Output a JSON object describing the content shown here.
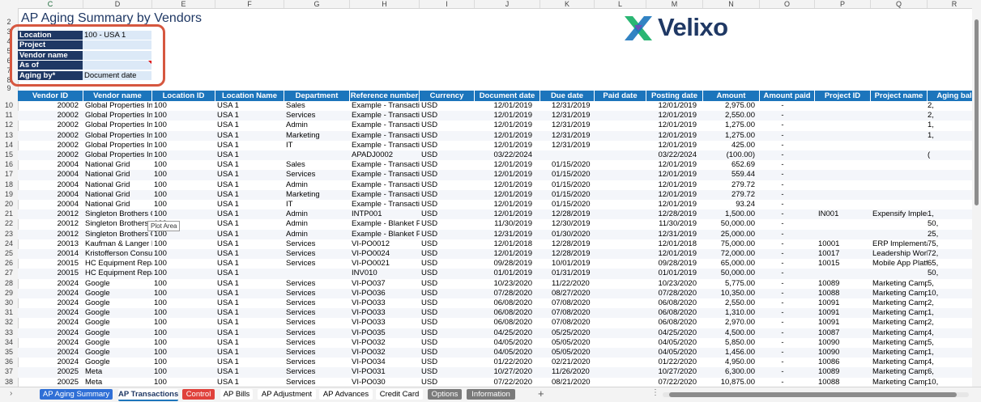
{
  "sheet": {
    "title": "AP Aging Summary by Vendors",
    "column_letters": [
      "C",
      "D",
      "E",
      "F",
      "G",
      "H",
      "I",
      "J",
      "K",
      "L",
      "M",
      "N",
      "O",
      "P",
      "Q",
      "R"
    ],
    "brand": "Velixo"
  },
  "params": [
    {
      "label": "Location",
      "value": "100 - USA 1"
    },
    {
      "label": "Project",
      "value": ""
    },
    {
      "label": "Vendor name",
      "value": ""
    },
    {
      "label": "As of",
      "value": ""
    },
    {
      "label": "Aging by*",
      "value": "Document date"
    }
  ],
  "table": {
    "headers": [
      "Vendor ID",
      "Vendor name",
      "Location ID",
      "Location Name",
      "Department",
      "Reference number",
      "Currency",
      "Document date",
      "Due date",
      "Paid date",
      "Posting date",
      "Amount",
      "Amount paid",
      "Project ID",
      "Project name",
      "Aging bal"
    ],
    "rows": [
      [
        "20002",
        "Global Properties In",
        "100",
        "USA 1",
        "Sales",
        "Example - Transactio",
        "USD",
        "12/01/2019",
        "12/31/2019",
        "",
        "12/01/2019",
        "2,975.00",
        "-",
        "",
        "",
        "2,"
      ],
      [
        "20002",
        "Global Properties In",
        "100",
        "USA 1",
        "Services",
        "Example - Transactio",
        "USD",
        "12/01/2019",
        "12/31/2019",
        "",
        "12/01/2019",
        "2,550.00",
        "-",
        "",
        "",
        "2,"
      ],
      [
        "20002",
        "Global Properties In",
        "100",
        "USA 1",
        "Admin",
        "Example - Transactio",
        "USD",
        "12/01/2019",
        "12/31/2019",
        "",
        "12/01/2019",
        "1,275.00",
        "-",
        "",
        "",
        "1,"
      ],
      [
        "20002",
        "Global Properties In",
        "100",
        "USA 1",
        "Marketing",
        "Example - Transactio",
        "USD",
        "12/01/2019",
        "12/31/2019",
        "",
        "12/01/2019",
        "1,275.00",
        "-",
        "",
        "",
        "1,"
      ],
      [
        "20002",
        "Global Properties In",
        "100",
        "USA 1",
        "IT",
        "Example - Transactio",
        "USD",
        "12/01/2019",
        "12/31/2019",
        "",
        "12/01/2019",
        "425.00",
        "-",
        "",
        "",
        ""
      ],
      [
        "20002",
        "Global Properties In",
        "100",
        "USA 1",
        "",
        "APADJ0002",
        "USD",
        "03/22/2024",
        "",
        "",
        "03/22/2024",
        "(100.00)",
        "-",
        "",
        "",
        "("
      ],
      [
        "20004",
        "National Grid",
        "100",
        "USA 1",
        "Sales",
        "Example - Transactio",
        "USD",
        "12/01/2019",
        "01/15/2020",
        "",
        "12/01/2019",
        "652.69",
        "-",
        "",
        "",
        ""
      ],
      [
        "20004",
        "National Grid",
        "100",
        "USA 1",
        "Services",
        "Example - Transactio",
        "USD",
        "12/01/2019",
        "01/15/2020",
        "",
        "12/01/2019",
        "559.44",
        "-",
        "",
        "",
        ""
      ],
      [
        "20004",
        "National Grid",
        "100",
        "USA 1",
        "Admin",
        "Example - Transactio",
        "USD",
        "12/01/2019",
        "01/15/2020",
        "",
        "12/01/2019",
        "279.72",
        "-",
        "",
        "",
        ""
      ],
      [
        "20004",
        "National Grid",
        "100",
        "USA 1",
        "Marketing",
        "Example - Transactio",
        "USD",
        "12/01/2019",
        "01/15/2020",
        "",
        "12/01/2019",
        "279.72",
        "-",
        "",
        "",
        ""
      ],
      [
        "20004",
        "National Grid",
        "100",
        "USA 1",
        "IT",
        "Example - Transactio",
        "USD",
        "12/01/2019",
        "01/15/2020",
        "",
        "12/01/2019",
        "93.24",
        "-",
        "",
        "",
        ""
      ],
      [
        "20012",
        "Singleton Brothers C",
        "100",
        "USA 1",
        "Admin",
        "INTP001",
        "USD",
        "12/01/2019",
        "12/28/2019",
        "",
        "12/28/2019",
        "1,500.00",
        "-",
        "IN001",
        "Expensify Impler",
        "1,"
      ],
      [
        "20012",
        "Singleton Brothers C",
        "100",
        "USA 1",
        "Admin",
        "Example - Blanket Pu",
        "USD",
        "11/30/2019",
        "12/30/2019",
        "",
        "11/30/2019",
        "50,000.00",
        "-",
        "",
        "",
        "50,"
      ],
      [
        "20012",
        "Singleton Brothers C",
        "100",
        "USA 1",
        "Admin",
        "Example - Blanket Pu",
        "USD",
        "12/31/2019",
        "01/30/2020",
        "",
        "12/31/2019",
        "25,000.00",
        "-",
        "",
        "",
        "25,"
      ],
      [
        "20013",
        "Kaufman & Langer L",
        "100",
        "USA 1",
        "Services",
        "VI-PO0012",
        "USD",
        "12/01/2018",
        "12/28/2019",
        "",
        "12/01/2018",
        "75,000.00",
        "-",
        "10001",
        "ERP Implementa",
        "75,"
      ],
      [
        "20014",
        "Kristofferson Consu",
        "100",
        "USA 1",
        "Services",
        "VI-PO0024",
        "USD",
        "12/01/2019",
        "12/28/2019",
        "",
        "12/01/2019",
        "72,000.00",
        "-",
        "10017",
        "Leadership Work",
        "72,"
      ],
      [
        "20015",
        "HC Equipment Repa",
        "100",
        "USA 1",
        "Services",
        "VI-PO0021",
        "USD",
        "09/28/2019",
        "10/01/2019",
        "",
        "09/28/2019",
        "65,000.00",
        "-",
        "10015",
        "Mobile App Platf",
        "65,"
      ],
      [
        "20015",
        "HC Equipment Repa",
        "100",
        "USA 1",
        "",
        "INV010",
        "USD",
        "01/01/2019",
        "01/31/2019",
        "",
        "01/01/2019",
        "50,000.00",
        "-",
        "",
        "",
        "50,"
      ],
      [
        "20024",
        "Google",
        "100",
        "USA 1",
        "Services",
        "VI-PO037",
        "USD",
        "10/23/2020",
        "11/22/2020",
        "",
        "10/23/2020",
        "5,775.00",
        "-",
        "10089",
        "Marketing Camp",
        "5,"
      ],
      [
        "20024",
        "Google",
        "100",
        "USA 1",
        "Services",
        "VI-PO036",
        "USD",
        "07/28/2020",
        "08/27/2020",
        "",
        "07/28/2020",
        "10,350.00",
        "-",
        "10088",
        "Marketing Camp",
        "10,"
      ],
      [
        "20024",
        "Google",
        "100",
        "USA 1",
        "Services",
        "VI-PO033",
        "USD",
        "06/08/2020",
        "07/08/2020",
        "",
        "06/08/2020",
        "2,550.00",
        "-",
        "10091",
        "Marketing Camp",
        "2,"
      ],
      [
        "20024",
        "Google",
        "100",
        "USA 1",
        "Services",
        "VI-PO033",
        "USD",
        "06/08/2020",
        "07/08/2020",
        "",
        "06/08/2020",
        "1,310.00",
        "-",
        "10091",
        "Marketing Camp",
        "1,"
      ],
      [
        "20024",
        "Google",
        "100",
        "USA 1",
        "Services",
        "VI-PO033",
        "USD",
        "06/08/2020",
        "07/08/2020",
        "",
        "06/08/2020",
        "2,970.00",
        "-",
        "10091",
        "Marketing Camp",
        "2,"
      ],
      [
        "20024",
        "Google",
        "100",
        "USA 1",
        "Services",
        "VI-PO035",
        "USD",
        "04/25/2020",
        "05/25/2020",
        "",
        "04/25/2020",
        "4,500.00",
        "-",
        "10087",
        "Marketing Camp",
        "4,"
      ],
      [
        "20024",
        "Google",
        "100",
        "USA 1",
        "Services",
        "VI-PO032",
        "USD",
        "04/05/2020",
        "05/05/2020",
        "",
        "04/05/2020",
        "5,850.00",
        "-",
        "10090",
        "Marketing Camp",
        "5,"
      ],
      [
        "20024",
        "Google",
        "100",
        "USA 1",
        "Services",
        "VI-PO032",
        "USD",
        "04/05/2020",
        "05/05/2020",
        "",
        "04/05/2020",
        "1,456.00",
        "-",
        "10090",
        "Marketing Camp",
        "1,"
      ],
      [
        "20024",
        "Google",
        "100",
        "USA 1",
        "Services",
        "VI-PO034",
        "USD",
        "01/22/2020",
        "02/21/2020",
        "",
        "01/22/2020",
        "4,950.00",
        "-",
        "10086",
        "Marketing Camp",
        "4,"
      ],
      [
        "20025",
        "Meta",
        "100",
        "USA 1",
        "Services",
        "VI-PO031",
        "USD",
        "10/27/2020",
        "11/26/2020",
        "",
        "10/27/2020",
        "6,300.00",
        "-",
        "10089",
        "Marketing Camp",
        "6,"
      ],
      [
        "20025",
        "Meta",
        "100",
        "USA 1",
        "Services",
        "VI-PO030",
        "USD",
        "07/22/2020",
        "08/21/2020",
        "",
        "07/22/2020",
        "10,875.00",
        "-",
        "10088",
        "Marketing Camp",
        "10,"
      ]
    ],
    "row_numbers": [
      "10",
      "11",
      "12",
      "13",
      "14",
      "15",
      "16",
      "17",
      "18",
      "19",
      "20",
      "21",
      "22",
      "23",
      "24",
      "25",
      "26",
      "27",
      "28",
      "29",
      "30",
      "31",
      "32",
      "33",
      "34",
      "35",
      "36",
      "37",
      "38"
    ]
  },
  "header_row_numbers": [
    "2",
    "3",
    "4",
    "5",
    "6",
    "7",
    "8",
    "9"
  ],
  "tooltip": "Plot Area",
  "tabs": [
    {
      "label": "AP Aging Summary",
      "bg": "#2f6fd6",
      "fg": "#ffffff"
    },
    {
      "label": "AP Transactions",
      "bg": "#ffffff",
      "fg": "#1f3864",
      "active": true
    },
    {
      "label": "Control",
      "bg": "#e0413b",
      "fg": "#ffffff"
    },
    {
      "label": "AP Bills",
      "bg": "#ffffff",
      "fg": "#000000"
    },
    {
      "label": "AP Adjustment",
      "bg": "#ffffff",
      "fg": "#000000"
    },
    {
      "label": "AP Advances",
      "bg": "#ffffff",
      "fg": "#000000"
    },
    {
      "label": "Credit Card",
      "bg": "#ffffff",
      "fg": "#000000"
    },
    {
      "label": "Options",
      "bg": "#7a7a7a",
      "fg": "#ffffff"
    },
    {
      "label": "Information",
      "bg": "#7a7a7a",
      "fg": "#ffffff"
    }
  ],
  "colors": {
    "header_blue": "#1c75bc",
    "param_navy": "#1f3864",
    "highlight": "#d6573f"
  }
}
